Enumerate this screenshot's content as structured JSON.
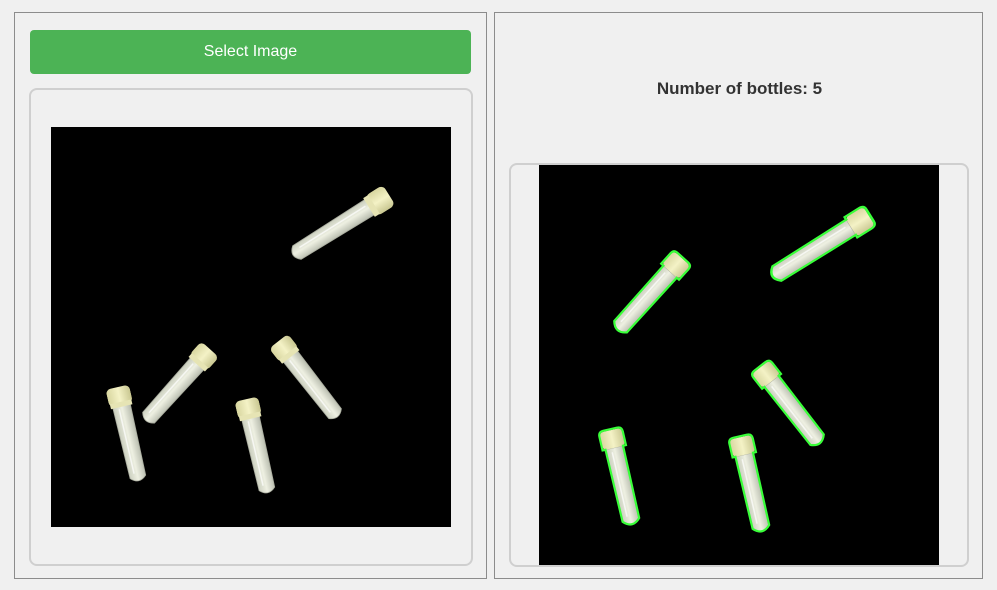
{
  "input_panel": {
    "select_button_label": "Select Image"
  },
  "result_panel": {
    "count_text": "Number of bottles: 5"
  },
  "colors": {
    "button_green": "#4cb355",
    "contour_green": "#39ff39",
    "image_background": "#000000"
  }
}
